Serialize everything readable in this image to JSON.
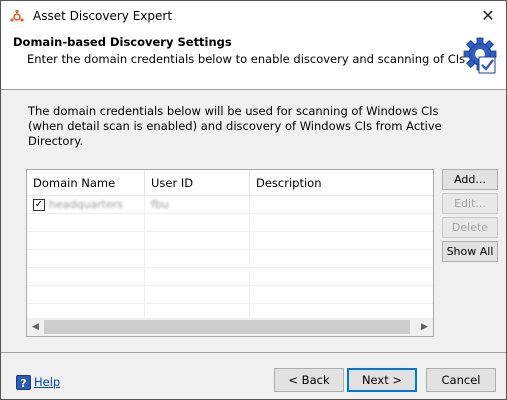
{
  "window": {
    "title": "Asset Discovery Expert",
    "close_glyph": "✕"
  },
  "header": {
    "title": "Domain-based Discovery Settings",
    "subtitle": "Enter the domain credentials below to enable discovery and scanning of CIs",
    "icon": "gear-check-icon"
  },
  "description": "The domain credentials below will be used for scanning of Windows CIs (when detail scan is enabled) and discovery of Windows CIs from Active Directory.",
  "table": {
    "columns": [
      "Domain Name",
      "User ID",
      "Description"
    ],
    "rows": [
      {
        "checked": true,
        "check_glyph": "✓",
        "domain": "headquarters",
        "user_id": "fbu",
        "description": ""
      }
    ]
  },
  "side_buttons": {
    "add": "Add...",
    "edit": "Edit...",
    "delete": "Delete",
    "show_all": "Show All"
  },
  "scrollbar": {
    "left_arrow": "◀",
    "right_arrow": "▶"
  },
  "footer": {
    "help_icon": "?",
    "help": "Help",
    "back": "< Back",
    "next": "Next >",
    "cancel": "Cancel"
  },
  "colors": {
    "accent": "#0078d7",
    "link": "#0046c8"
  }
}
